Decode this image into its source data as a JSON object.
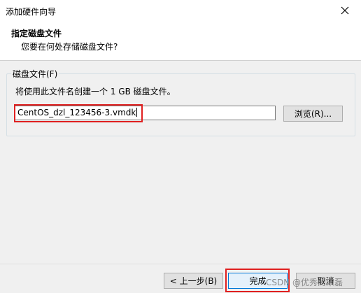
{
  "window": {
    "title": "添加硬件向导",
    "close_icon": "close-icon"
  },
  "header": {
    "title": "指定磁盘文件",
    "subtitle": "您要在何处存储磁盘文件?"
  },
  "disk_group": {
    "legend": "磁盘文件(F)",
    "description": "将使用此文件名创建一个 1 GB 磁盘文件。",
    "file_value": "CentOS_dzl_123456-3.vmdk",
    "browse_label": "浏览(R)..."
  },
  "footer": {
    "back_label": "< 上一步(B)",
    "finish_label": "完成",
    "cancel_label": "取消"
  },
  "watermark": "CSDN @优秀的宋磊",
  "colors": {
    "highlight": "#e02020",
    "focus": "#0078d7"
  }
}
